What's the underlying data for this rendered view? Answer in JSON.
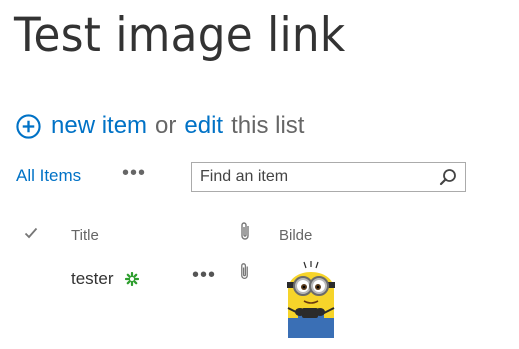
{
  "page": {
    "title": "Test image link"
  },
  "quick_actions": {
    "new_item_label": "new item",
    "or_text": "or",
    "edit_label": "edit",
    "this_list_text": "this list"
  },
  "view": {
    "current_view": "All Items",
    "more_label": "•••",
    "search": {
      "placeholder": "Find an item",
      "value": ""
    }
  },
  "list": {
    "columns": [
      "Title",
      "Bilde"
    ],
    "rows": [
      {
        "title": "tester",
        "more_label": "•••"
      }
    ]
  },
  "colors": {
    "link": "#0072c6",
    "new_badge": "#2e9e2e",
    "text": "#333333"
  }
}
